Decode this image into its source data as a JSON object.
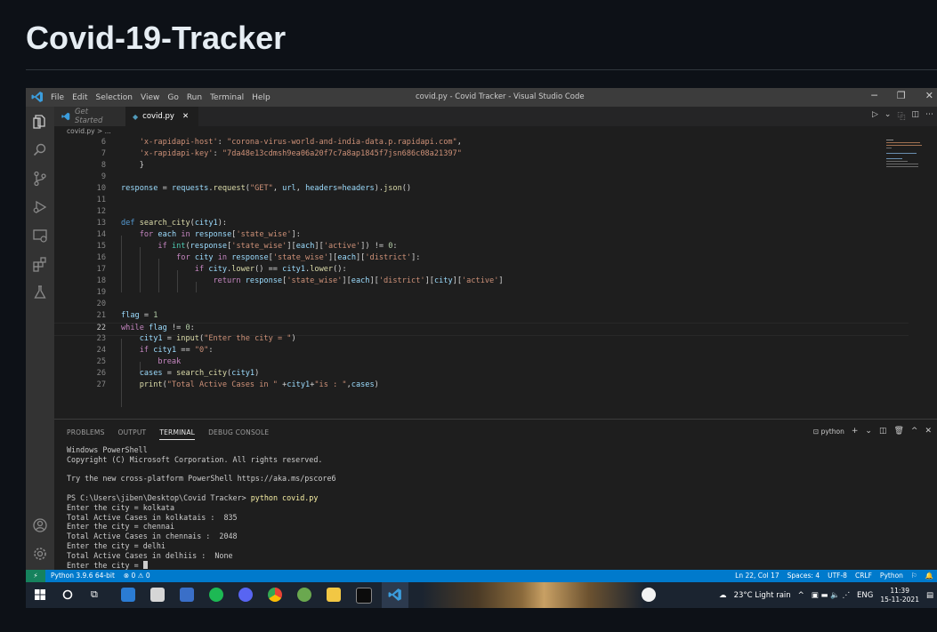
{
  "page": {
    "title": "Covid-19-Tracker"
  },
  "vscode": {
    "menu": [
      "File",
      "Edit",
      "Selection",
      "View",
      "Go",
      "Run",
      "Terminal",
      "Help"
    ],
    "window_title": "covid.py - Covid Tracker - Visual Studio Code",
    "window_controls": [
      "─",
      "❐",
      "✕"
    ],
    "tabs": [
      {
        "label": "Get Started",
        "active": false
      },
      {
        "label": "covid.py",
        "active": true,
        "close": "✕"
      }
    ],
    "tab_actions": [
      "▷",
      "⌄",
      "⿻",
      "◫",
      "⋯"
    ],
    "breadcrumb": "covid.py > ...",
    "editor": {
      "current_line": 22,
      "lines": [
        {
          "n": "6"
        },
        {
          "n": "7"
        },
        {
          "n": "8"
        },
        {
          "n": "9"
        },
        {
          "n": "10"
        },
        {
          "n": "11"
        },
        {
          "n": "12"
        },
        {
          "n": "13"
        },
        {
          "n": "14"
        },
        {
          "n": "15"
        },
        {
          "n": "16"
        },
        {
          "n": "17"
        },
        {
          "n": "18"
        },
        {
          "n": "19"
        },
        {
          "n": "20"
        },
        {
          "n": "21"
        },
        {
          "n": "22"
        },
        {
          "n": "23"
        },
        {
          "n": "24"
        },
        {
          "n": "25"
        },
        {
          "n": "26"
        },
        {
          "n": "27"
        }
      ]
    },
    "panel": {
      "tabs": [
        "PROBLEMS",
        "OUTPUT",
        "TERMINAL",
        "DEBUG CONSOLE"
      ],
      "active_tab": "TERMINAL",
      "shell_label": "python",
      "actions": [
        "+",
        "⌄",
        "◫",
        "🗑",
        "^",
        "✕"
      ],
      "terminal_lines": [
        "Windows PowerShell",
        "Copyright (C) Microsoft Corporation. All rights reserved.",
        "",
        "Try the new cross-platform PowerShell https://aka.ms/pscore6",
        "",
        "Enter the city = kolkata",
        "Total Active Cases in kolkatais :  835",
        "Enter the city = chennai",
        "Total Active Cases in chennais :  2048",
        "Enter the city = delhi",
        "Total Active Cases in delhiis :  None",
        "Enter the city = "
      ],
      "prompt": "PS C:\\Users\\jiben\\Desktop\\Covid Tracker>",
      "command": "python covid.py"
    },
    "status": {
      "python": "Python 3.9.6 64-bit",
      "problems": "⊗ 0  ⚠ 0",
      "position": "Ln 22, Col 17",
      "spaces": "Spaces: 4",
      "encoding": "UTF-8",
      "eol": "CRLF",
      "language": "Python"
    }
  },
  "taskbar": {
    "weather": "23°C  Light rain",
    "lang": "ENG",
    "time": "11:39",
    "date": "15-11-2021"
  },
  "colors": {
    "page_bg": "#0d1117",
    "status_bar": "#007acc",
    "keyword": "#569cd6",
    "string": "#ce9178",
    "function": "#dcdcaa"
  }
}
